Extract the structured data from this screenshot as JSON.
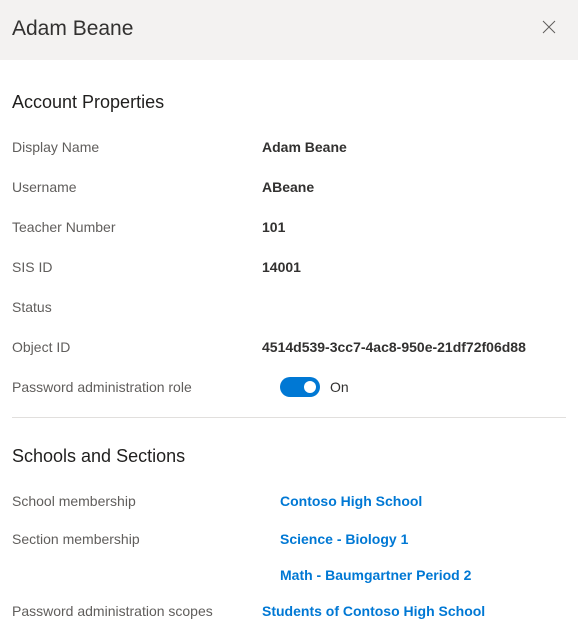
{
  "header": {
    "title": "Adam Beane"
  },
  "properties": {
    "section_title": "Account Properties",
    "rows": {
      "display_name": {
        "label": "Display Name",
        "value": "Adam Beane"
      },
      "username": {
        "label": "Username",
        "value": "ABeane"
      },
      "teacher_number": {
        "label": "Teacher Number",
        "value": "101"
      },
      "sis_id": {
        "label": "SIS ID",
        "value": "14001"
      },
      "status": {
        "label": "Status",
        "value": ""
      },
      "object_id": {
        "label": "Object ID",
        "value": "4514d539-3cc7-4ac8-950e-21df72f06d88"
      },
      "pwd_admin_role": {
        "label": "Password administration role",
        "toggle_state": "On"
      }
    }
  },
  "schools": {
    "section_title": "Schools and Sections",
    "school_membership": {
      "label": "School membership",
      "value": "Contoso High School"
    },
    "section_membership": {
      "label": "Section membership",
      "values": [
        "Science - Biology 1",
        "Math - Baumgartner Period 2"
      ]
    },
    "pwd_admin_scopes": {
      "label": "Password administration scopes",
      "value": "Students of Contoso High School"
    }
  }
}
